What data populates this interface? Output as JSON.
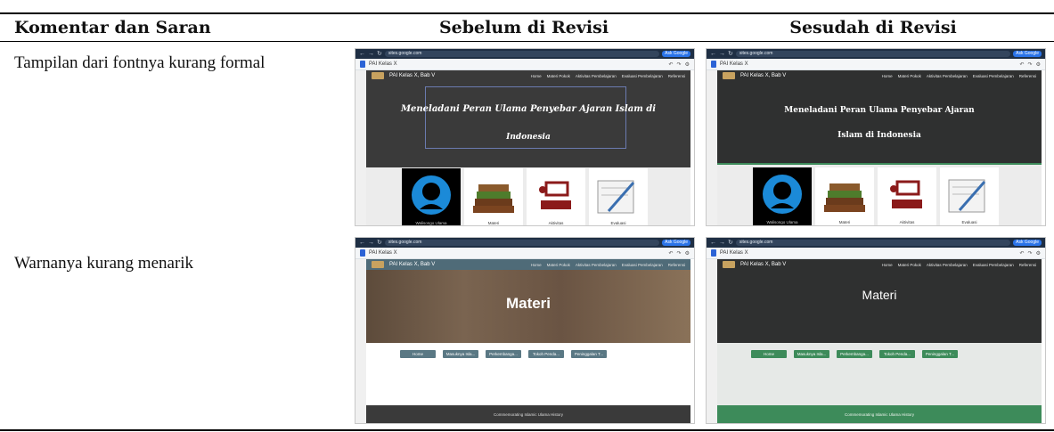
{
  "table": {
    "headers": [
      "Komentar dan Saran",
      "Sebelum di Revisi",
      "Sesudah di Revisi"
    ],
    "rows": [
      {
        "comment": "Tampilan dari fontnya kurang formal"
      },
      {
        "comment": "Warnanya kurang menarik"
      }
    ]
  },
  "browser": {
    "url": "sites.google.com",
    "ask_label": "Ask Google",
    "doc_title": "PAI Kelas X"
  },
  "site": {
    "brand": "PAI Kelas X, Bab V",
    "nav": [
      "Home",
      "Materi Pokok",
      "Aktivitas Pembelajaran",
      "Evaluasi Pembelajaran",
      "Referensi"
    ]
  },
  "row1": {
    "before_title_line1": "Meneladani Peran Ulama Penyebar Ajaran Islam di",
    "before_title_line2": "Indonesia",
    "after_title_line1": "Meneladani Peran Ulama Penyebar Ajaran",
    "after_title_line2": "Islam di Indonesia",
    "cards": [
      "Walisongo Ulama",
      "Materi",
      "Aktivitas",
      "Evaluasi"
    ]
  },
  "row2": {
    "title": "Materi",
    "buttons": [
      "Home",
      "Masuknya Isla...",
      "Perkembanga...",
      "Tokoh Penda...",
      "Peninggalan T..."
    ],
    "footer": "Commemorating Islamic Ulama History"
  },
  "colors": {
    "before_hero": "#3a3a3a",
    "after_hero": "#2f3030",
    "before_nav2": "#4f6b78",
    "after_green": "#3d8b5a",
    "before_btn": "#5a7884",
    "after_btn": "#3d8b5a"
  }
}
